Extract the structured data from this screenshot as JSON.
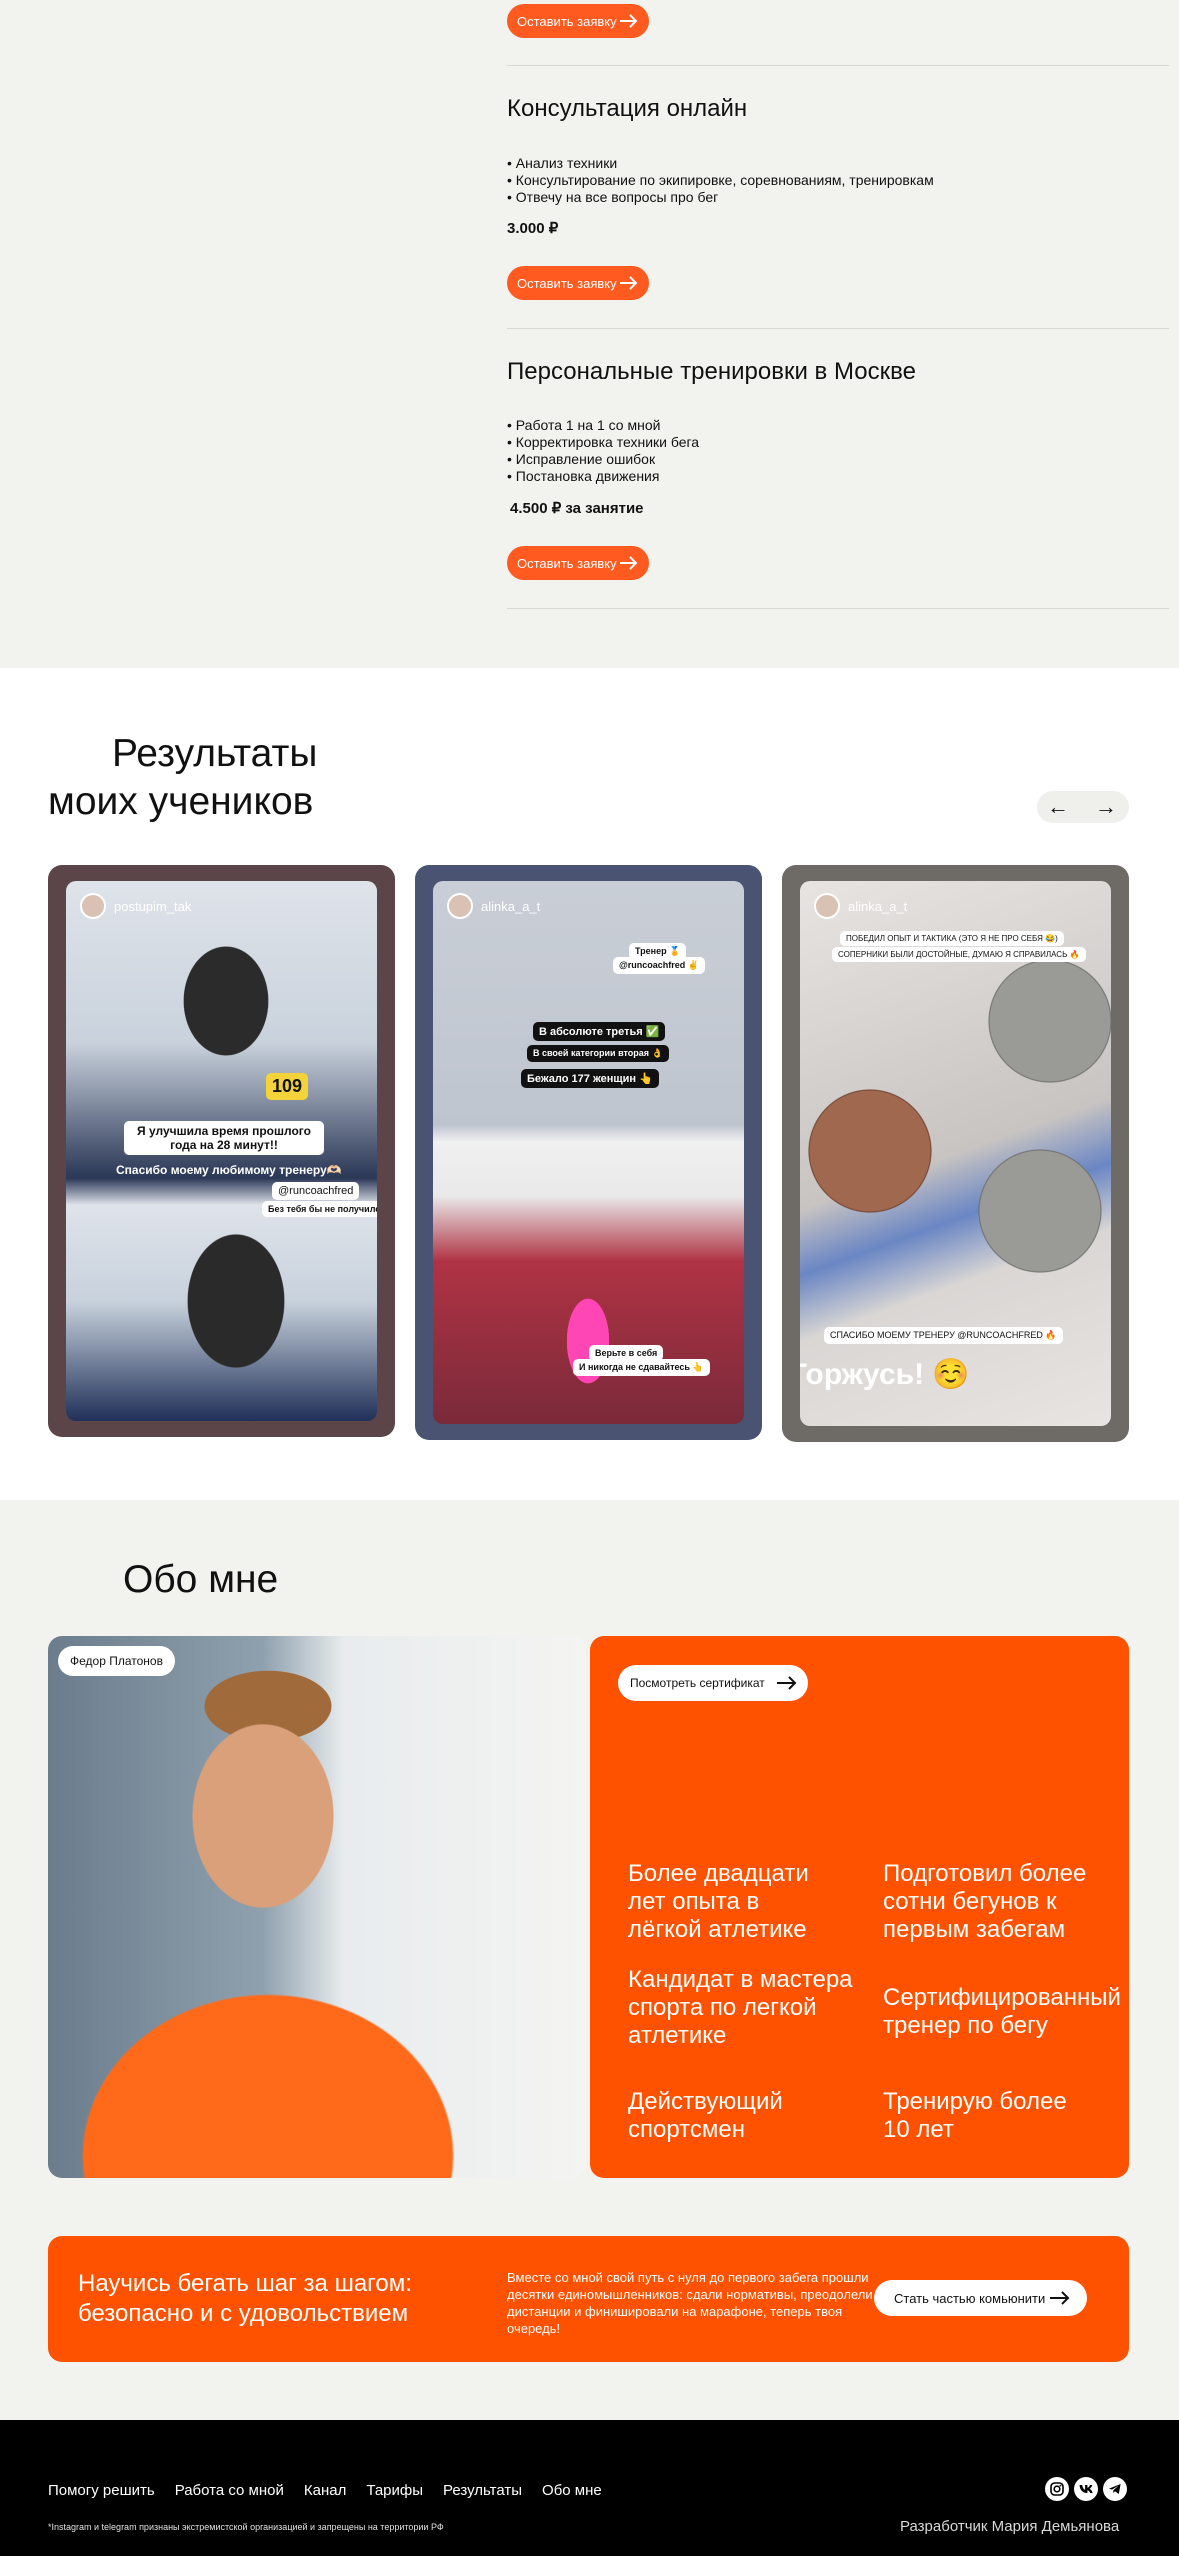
{
  "services": {
    "button_label": "Оставить заявку",
    "items": [
      {
        "title": "Консультация онлайн",
        "bullets": [
          "Анализ техники",
          "Консультирование по экипировке, соревнованиям, тренировкам",
          "Отвечу на все вопросы про бег"
        ],
        "price": "3.000 ₽"
      },
      {
        "title": "Персональные тренировки в Москве",
        "bullets": [
          "Работа 1 на 1 со мной",
          "Корректировка техники бега",
          "Исправление ошибок",
          "Постановка движения"
        ],
        "price": "4.500 ₽ за занятие"
      }
    ]
  },
  "results": {
    "title_line1": "Результаты",
    "title_line2": "моих учеников",
    "prev_icon": "←",
    "next_icon": "→",
    "cards": [
      {
        "handle": "postupim_tak",
        "stickers": [
          "Я улучшила время прошлого года на 28 минут!!",
          "Спасибо моему любимому тренеру🫶🏻",
          "@runcoachfred",
          "Без тебя бы не получилось",
          "109"
        ]
      },
      {
        "handle": "alinka_a_t",
        "stickers": [
          "Тренер 🏅",
          "@runcoachfred ✌️",
          "В абсолюте третья ✅",
          "В своей категории вторая 👌",
          "Бежало 177 женщин 👆",
          "Верьте в себя",
          "И никогда не сдавайтесь 👆"
        ]
      },
      {
        "handle": "alinka_a_t",
        "stickers": [
          "ПОБЕДИЛ ОПЫТ И ТАКТИКА (ЭТО Я НЕ ПРО СЕБЯ 😂)",
          "СОПЕРНИКИ БЫЛИ ДОСТОЙНЫЕ, ДУМАЮ Я СПРАВИЛАСЬ 🔥",
          "СПАСИБО МОЕМУ ТРЕНЕРУ @RUNCOACHFRED 🔥",
          "Горжусь! ☺️"
        ]
      }
    ]
  },
  "about": {
    "title": "Обо мне",
    "name_tag": "Федор Платонов",
    "cert_button": "Посмотреть сертификат",
    "facts": [
      "Более двадцати лет опыта в лёгкой атлетике",
      "Подготовил более сотни бегунов к первым забегам",
      "Кандидат в мастера спорта по легкой атлетике",
      "Сертифицированный тренер по бегу",
      "Действующий спортсмен",
      "Тренирую более 10 лет"
    ]
  },
  "cta": {
    "title": "Научись бегать шаг за шагом: безопасно и с удовольствием",
    "text": "Вместе со мной свой путь с нуля до первого забега прошли десятки единомышленников: сдали нормативы, преодолели дистанции и финишировали на марафоне, теперь твоя очередь!",
    "button": "Стать частью комьюнити"
  },
  "footer": {
    "nav": [
      "Помогу решить",
      "Работа со мной",
      "Канал",
      "Тарифы",
      "Результаты",
      "Обо мне"
    ],
    "note": "*Instagram и telegram признаны экстремистской организацией и запрещены на территории РФ",
    "developer": "Разработчик Мария Демьянова",
    "socials": [
      "instagram-icon",
      "vk-icon",
      "telegram-icon"
    ]
  },
  "colors": {
    "accent": "#ff5a1f",
    "accent_dark": "#ff5200",
    "bg": "#f2f2ee",
    "footer": "#000000"
  }
}
